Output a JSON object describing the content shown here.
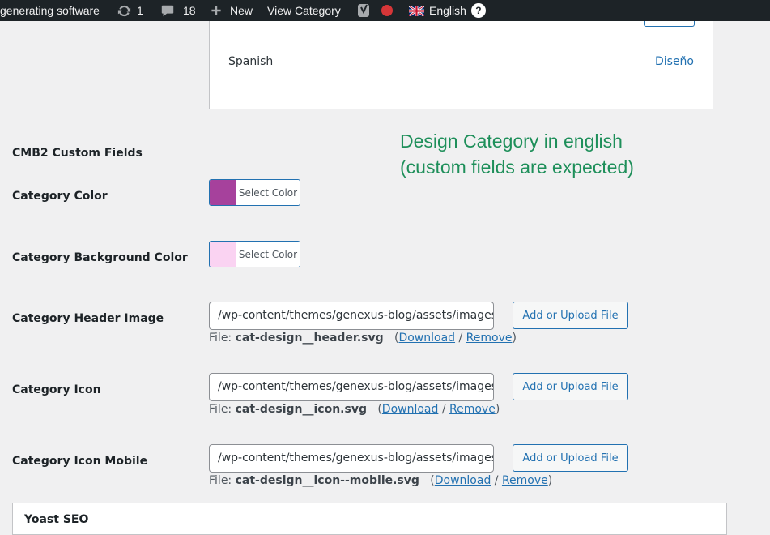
{
  "adminbar": {
    "site_name": "generating software",
    "updates_count": "1",
    "comments_count": "18",
    "new_label": "New",
    "view_label": "View Category",
    "language_label": "English",
    "help_glyph": "?",
    "record_color": "#d63638"
  },
  "languages": {
    "row_name": "Spanish",
    "row_link": "Diseño"
  },
  "annotation": {
    "line1": "Design Category in english",
    "line2": "(custom fields are expected)"
  },
  "cmb2": {
    "section_title": "CMB2 Custom Fields",
    "category_color": {
      "label": "Category Color",
      "button": "Select Color",
      "swatch": "#a6419c"
    },
    "background_color": {
      "label": "Category Background Color",
      "button": "Select Color",
      "swatch": "#fad3f2"
    },
    "header_image": {
      "label": "Category Header Image",
      "value": "/wp-content/themes/genexus-blog/assets/images/categories/cat-design__header.svg",
      "button": "Add or Upload File",
      "file_prefix": "File:",
      "file_name": "cat-design__header.svg",
      "download": "Download",
      "remove": "Remove"
    },
    "icon": {
      "label": "Category Icon",
      "value": "/wp-content/themes/genexus-blog/assets/images/categories/cat-design__icon.svg",
      "button": "Add or Upload File",
      "file_prefix": "File:",
      "file_name": "cat-design__icon.svg",
      "download": "Download",
      "remove": "Remove"
    },
    "icon_mobile": {
      "label": "Category Icon Mobile",
      "value": "/wp-content/themes/genexus-blog/assets/images/categories/cat-design__icon--mobile.svg",
      "button": "Add or Upload File",
      "file_prefix": "File:",
      "file_name": "cat-design__icon--mobile.svg",
      "download": "Download",
      "remove": "Remove"
    }
  },
  "yoast": {
    "title": "Yoast SEO"
  }
}
